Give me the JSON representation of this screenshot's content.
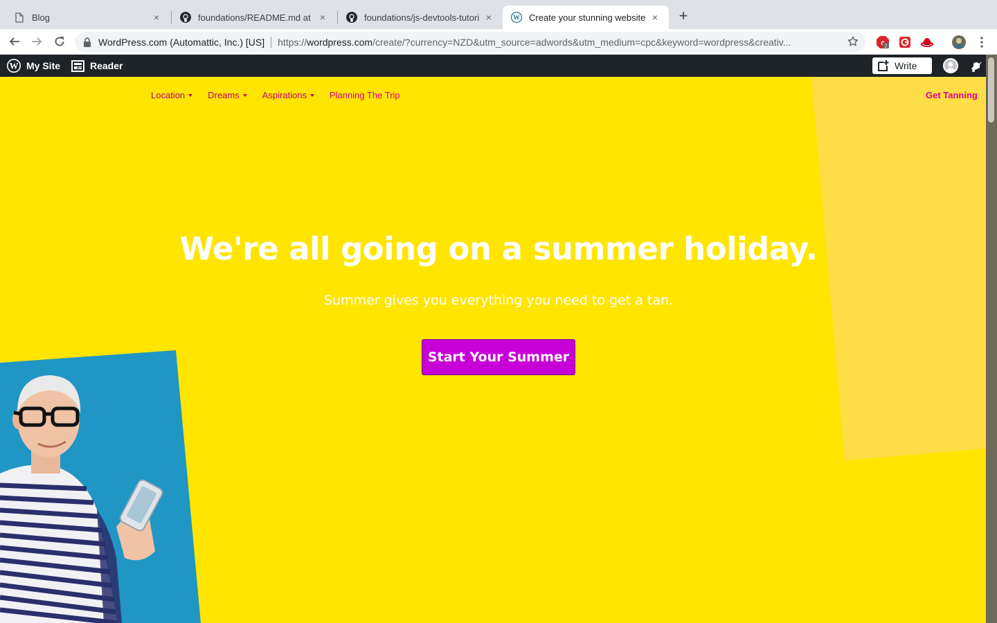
{
  "browser": {
    "tabs": [
      {
        "title": "Blog",
        "icon": "document-icon"
      },
      {
        "title": "foundations/README.md at ma",
        "icon": "github-icon"
      },
      {
        "title": "foundations/js-devtools-tutoria",
        "icon": "github-icon"
      },
      {
        "title": "Create your stunning website o",
        "icon": "wordpress-icon",
        "active": true
      }
    ],
    "new_tab_label": "+",
    "close_label": "×",
    "site_identity": "WordPress.com (Automattic, Inc.) [US]",
    "url": {
      "scheme": "https://",
      "host": "wordpress.com",
      "rest": "/create/?currency=NZD&utm_source=adwords&utm_medium=cpc&keyword=wordpress&creativ..."
    },
    "extension_badge": "2"
  },
  "admin_bar": {
    "my_site": "My Site",
    "reader": "Reader",
    "write": "Write"
  },
  "site": {
    "nav": [
      {
        "label": "Location",
        "has_dropdown": true
      },
      {
        "label": "Dreams",
        "has_dropdown": true
      },
      {
        "label": "Aspirations",
        "has_dropdown": true
      },
      {
        "label": "Planning The Trip",
        "has_dropdown": false
      }
    ],
    "cta_nav": "Get Tanning",
    "hero": {
      "title": "We're all going on a summer holiday.",
      "subtitle": "Summer gives you everything you need to get a tan.",
      "button": "Start Your Summer"
    }
  },
  "colors": {
    "page_background": "#ffe500",
    "accent_shape": "#ffdd47",
    "nav_link": "#c3007a",
    "button": "#c700d8",
    "admin_bar": "#1d2327",
    "photo_background": "#1f96c4"
  }
}
